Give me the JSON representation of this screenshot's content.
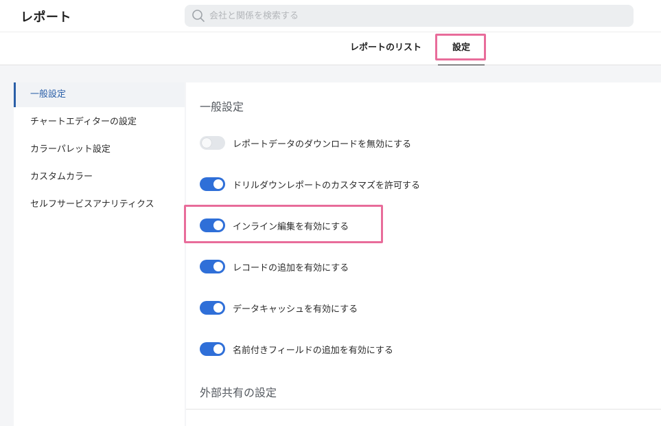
{
  "header": {
    "title": "レポート",
    "search": {
      "placeholder": "会社と関係を検索する",
      "value": "",
      "icon": "search-icon"
    }
  },
  "tabs": [
    {
      "label": "レポートのリスト",
      "active": false
    },
    {
      "label": "設定",
      "active": true
    }
  ],
  "sidebar": {
    "items": [
      {
        "label": "一般設定",
        "active": true
      },
      {
        "label": "チャートエディターの設定",
        "active": false
      },
      {
        "label": "カラーパレット設定",
        "active": false
      },
      {
        "label": "カスタムカラー",
        "active": false
      },
      {
        "label": "セルフサービスアナリティクス",
        "active": false
      }
    ]
  },
  "main": {
    "section_title": "一般設定",
    "settings": [
      {
        "label": "レポートデータのダウンロードを無効にする",
        "enabled": false
      },
      {
        "label": "ドリルダウンレポートのカスタマズを許可する",
        "enabled": true
      },
      {
        "label": "インライン編集を有効にする",
        "enabled": true
      },
      {
        "label": "レコードの追加を有効にする",
        "enabled": true
      },
      {
        "label": "データキャッシュを有効にする",
        "enabled": true
      },
      {
        "label": "名前付きフィールドの追加を有効にする",
        "enabled": true
      }
    ],
    "section2_title": "外部共有の設定"
  },
  "colors": {
    "accent": "#2f6fd8",
    "active_sidebar": "#2a5fa8",
    "highlight": "#e86c9a",
    "toggle_off": "#e3e6ea"
  }
}
